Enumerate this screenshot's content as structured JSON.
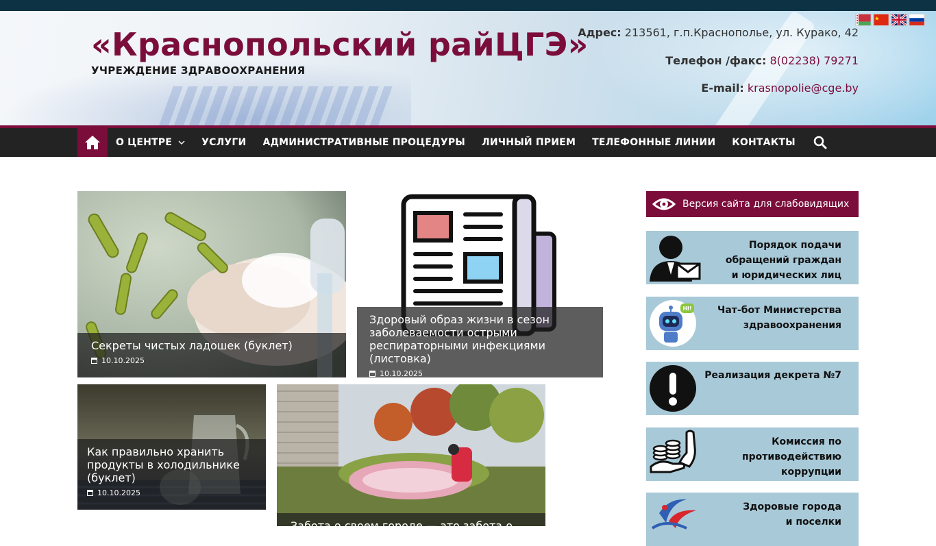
{
  "header": {
    "title": "«Краснопольский райЦГЭ»",
    "subtitle": "УЧРЕЖДЕНИЕ ЗДРАВООХРАНЕНИЯ",
    "address_label": "Адрес:",
    "address_value": "213561, г.п.Краснополье, ул. Курако, 42",
    "phone_label": "Телефон /факс:",
    "phone_value": "8(02238) 79271",
    "email_label": "E-mail:",
    "email_value": "krasnopolie@cge.by",
    "languages": [
      "be",
      "zh",
      "en",
      "ru"
    ]
  },
  "nav": {
    "items": [
      "О ЦЕНТРЕ",
      "УСЛУГИ",
      "АДМИНИСТРАТИВНЫЕ ПРОЦЕДУРЫ",
      "ЛИЧНЫЙ ПРИЕМ",
      "ТЕЛЕФОННЫЕ ЛИНИИ",
      "КОНТАКТЫ"
    ],
    "home_icon": "home-icon",
    "search_icon": "search-icon"
  },
  "posts": [
    {
      "title": "Секреты чистых ладошек (буклет)",
      "date": "10.10.2025"
    },
    {
      "title": "Здоровый образ жизни в сезон заболеваемости острыми респираторными инфекциями (листовка)",
      "date": "10.10.2025"
    },
    {
      "title": "Как правильно хранить продукты в холодильнике (буклет)",
      "date": "10.10.2025"
    },
    {
      "title": "Забота о своем городе — это забота о своем",
      "date": ""
    }
  ],
  "sidebar": {
    "accessibility": "Версия сайта для слабовидящих",
    "banners": [
      "Порядок подачи\nобращений граждан\nи юридических лиц",
      "Чат-бот Министерства\nздравоохранения",
      "Реализация декрета №7",
      "Комиссия по\nпротиводействию\nкоррупции",
      "Здоровые города\nи поселки"
    ],
    "chatbot_badge": "HI!"
  },
  "colors": {
    "brand": "#7b0d3b",
    "nav_bg": "#232323",
    "topbar": "#0c3243",
    "banner_bg": "#a8c9d8"
  }
}
